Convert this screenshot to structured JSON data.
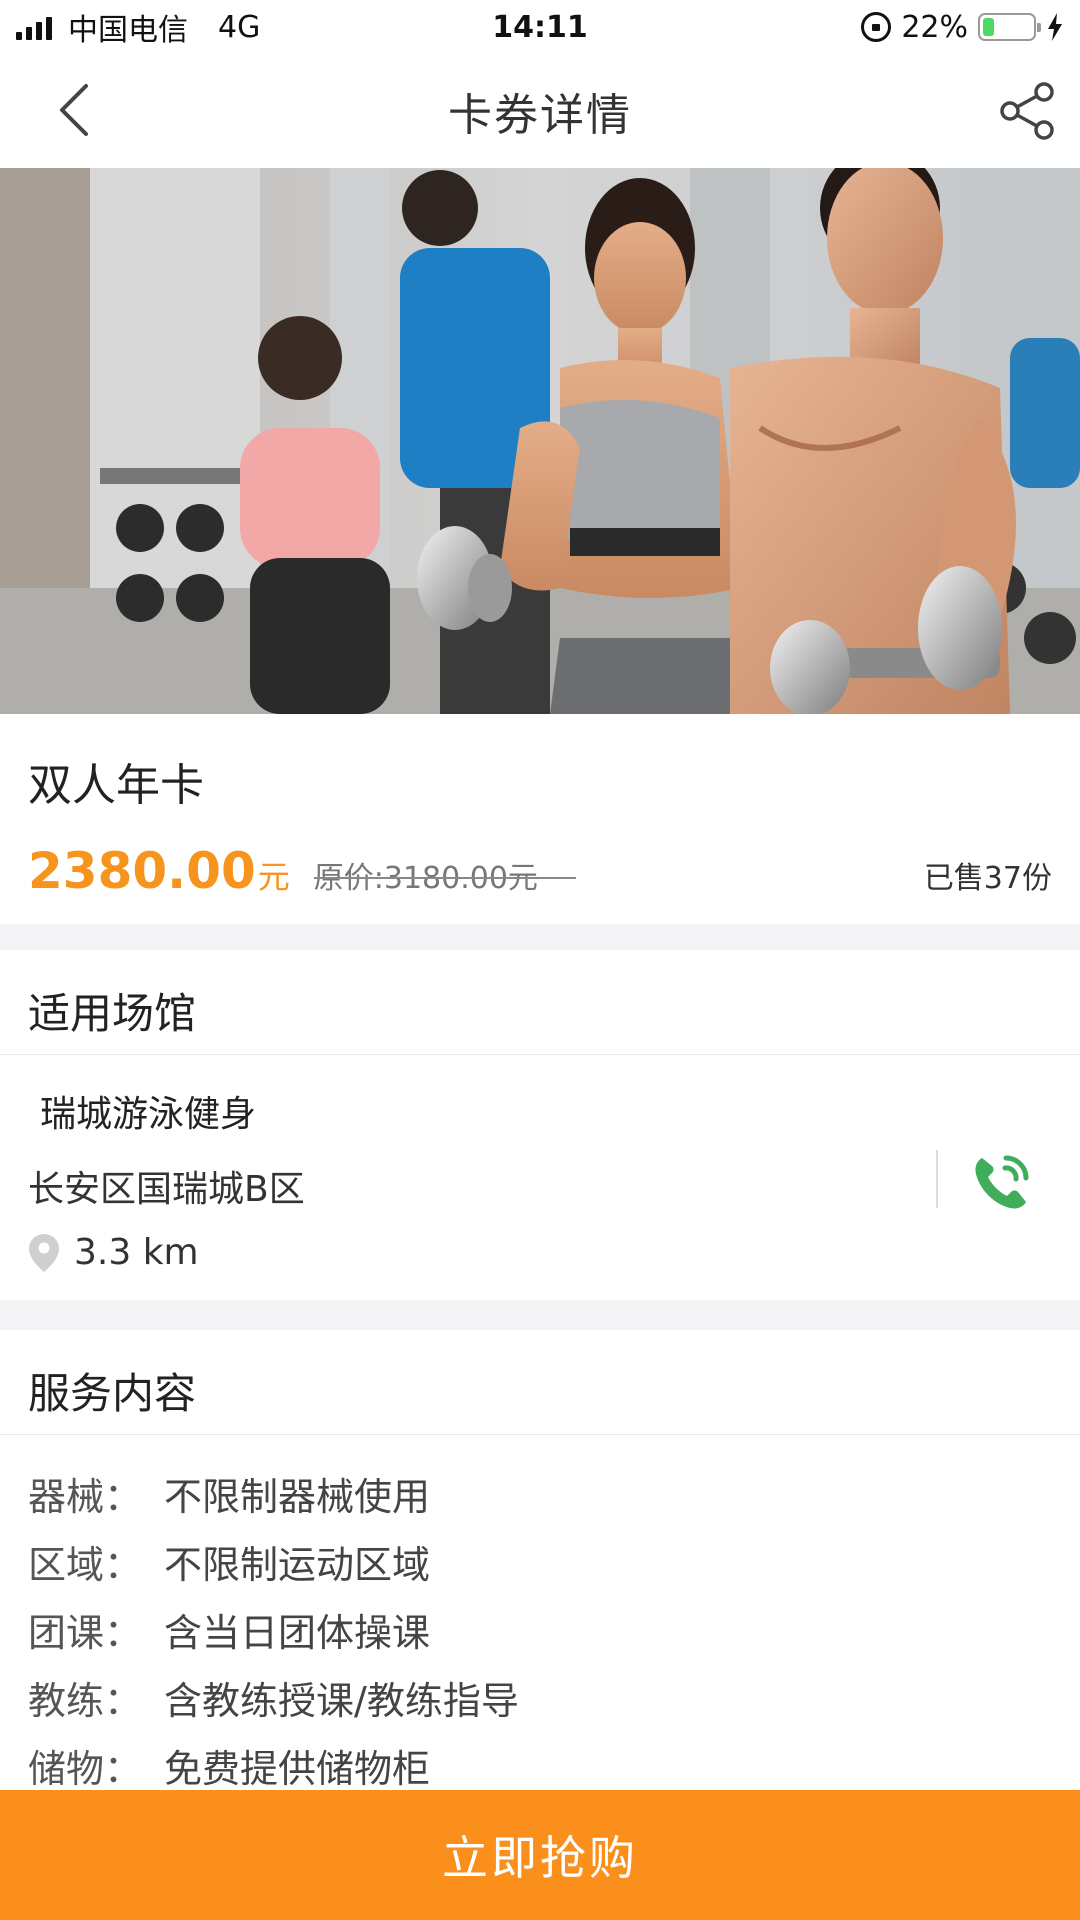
{
  "status_bar": {
    "carrier": "中国电信",
    "network": "4G",
    "time": "14:11",
    "battery_text": "22%",
    "battery_level": 0.22
  },
  "nav": {
    "title": "卡券详情",
    "back_icon": "chevron-left-icon",
    "share_icon": "share-icon"
  },
  "hero": {
    "image": "gym-photo"
  },
  "card": {
    "name": "双人年卡",
    "price": "2380.00",
    "price_unit": "元",
    "original_price": "原价:3180.00元",
    "sold": "已售37份",
    "accent_color": "#f7941d"
  },
  "venue": {
    "section_title": "适用场馆",
    "name": "瑞城游泳健身",
    "address": "长安区国瑞城B区",
    "distance": "3.3 km",
    "phone_icon": "phone-icon",
    "pin_icon": "location-pin-icon",
    "phone_color": "#3fad5a"
  },
  "service": {
    "section_title": "服务内容",
    "items": [
      {
        "key": "器械：",
        "value": "不限制器械使用"
      },
      {
        "key": "区域：",
        "value": "不限制运动区域"
      },
      {
        "key": "团课：",
        "value": "含当日团体操课"
      },
      {
        "key": "教练：",
        "value": "含教练授课/教练指导"
      },
      {
        "key": "储物：",
        "value": "免费提供储物柜"
      }
    ]
  },
  "footer": {
    "buy_label": "立即抢购",
    "button_color": "#fb8f1c"
  }
}
